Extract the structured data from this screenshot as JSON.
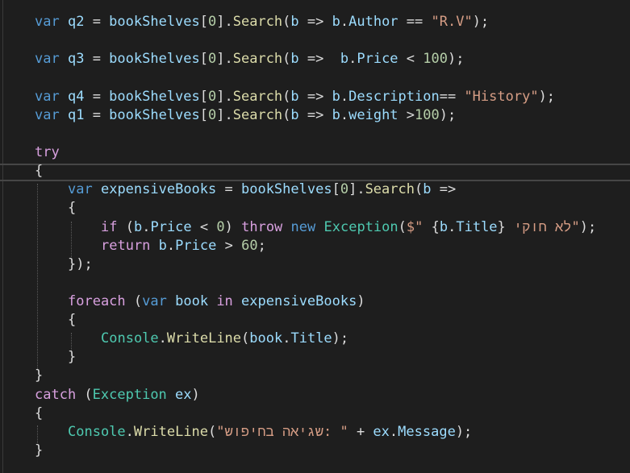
{
  "lines": [
    {
      "tokens": [
        {
          "t": "var",
          "c": "kw"
        },
        {
          "t": " ",
          "c": "pun"
        },
        {
          "t": "q2",
          "c": "id"
        },
        {
          "t": " = ",
          "c": "pun"
        },
        {
          "t": "bookShelves",
          "c": "id"
        },
        {
          "t": "[",
          "c": "pun"
        },
        {
          "t": "0",
          "c": "num"
        },
        {
          "t": "].",
          "c": "pun"
        },
        {
          "t": "Search",
          "c": "mth"
        },
        {
          "t": "(",
          "c": "pun"
        },
        {
          "t": "b",
          "c": "id"
        },
        {
          "t": " => ",
          "c": "pun"
        },
        {
          "t": "b",
          "c": "id"
        },
        {
          "t": ".",
          "c": "pun"
        },
        {
          "t": "Author",
          "c": "id"
        },
        {
          "t": " == ",
          "c": "pun"
        },
        {
          "t": "\"R.V\"",
          "c": "str"
        },
        {
          "t": ");",
          "c": "pun"
        }
      ]
    },
    {
      "tokens": [
        {
          "t": "var",
          "c": "kw"
        },
        {
          "t": " ",
          "c": "pun"
        },
        {
          "t": "q3",
          "c": "id"
        },
        {
          "t": " = ",
          "c": "pun"
        },
        {
          "t": "bookShelves",
          "c": "id"
        },
        {
          "t": "[",
          "c": "pun"
        },
        {
          "t": "0",
          "c": "num"
        },
        {
          "t": "].",
          "c": "pun"
        },
        {
          "t": "Search",
          "c": "mth"
        },
        {
          "t": "(",
          "c": "pun"
        },
        {
          "t": "b",
          "c": "id"
        },
        {
          "t": " =>  ",
          "c": "pun"
        },
        {
          "t": "b",
          "c": "id"
        },
        {
          "t": ".",
          "c": "pun"
        },
        {
          "t": "Price",
          "c": "id"
        },
        {
          "t": " < ",
          "c": "pun"
        },
        {
          "t": "100",
          "c": "num"
        },
        {
          "t": ");",
          "c": "pun"
        }
      ]
    },
    {
      "tokens": [
        {
          "t": "var",
          "c": "kw"
        },
        {
          "t": " ",
          "c": "pun"
        },
        {
          "t": "q4",
          "c": "id"
        },
        {
          "t": " = ",
          "c": "pun"
        },
        {
          "t": "bookShelves",
          "c": "id"
        },
        {
          "t": "[",
          "c": "pun"
        },
        {
          "t": "0",
          "c": "num"
        },
        {
          "t": "].",
          "c": "pun"
        },
        {
          "t": "Search",
          "c": "mth"
        },
        {
          "t": "(",
          "c": "pun"
        },
        {
          "t": "b",
          "c": "id"
        },
        {
          "t": " => ",
          "c": "pun"
        },
        {
          "t": "b",
          "c": "id"
        },
        {
          "t": ".",
          "c": "pun"
        },
        {
          "t": "Description",
          "c": "id"
        },
        {
          "t": "== ",
          "c": "pun"
        },
        {
          "t": "\"History\"",
          "c": "str"
        },
        {
          "t": ");",
          "c": "pun"
        }
      ]
    },
    {
      "tokens": [
        {
          "t": "var",
          "c": "kw"
        },
        {
          "t": " ",
          "c": "pun"
        },
        {
          "t": "q1",
          "c": "id"
        },
        {
          "t": " = ",
          "c": "pun"
        },
        {
          "t": "bookShelves",
          "c": "id"
        },
        {
          "t": "[",
          "c": "pun"
        },
        {
          "t": "0",
          "c": "num"
        },
        {
          "t": "].",
          "c": "pun"
        },
        {
          "t": "Search",
          "c": "mth"
        },
        {
          "t": "(",
          "c": "pun"
        },
        {
          "t": "b",
          "c": "id"
        },
        {
          "t": " => ",
          "c": "pun"
        },
        {
          "t": "b",
          "c": "id"
        },
        {
          "t": ".",
          "c": "pun"
        },
        {
          "t": "weight",
          "c": "id"
        },
        {
          "t": " >",
          "c": "pun"
        },
        {
          "t": "100",
          "c": "num"
        },
        {
          "t": ");",
          "c": "pun"
        }
      ]
    },
    {
      "tokens": [
        {
          "t": "try",
          "c": "ctl"
        }
      ]
    },
    {
      "tokens": [
        {
          "t": "{",
          "c": "pun"
        }
      ]
    },
    {
      "tokens": [
        {
          "t": "var",
          "c": "kw"
        },
        {
          "t": " ",
          "c": "pun"
        },
        {
          "t": "expensiveBooks",
          "c": "id"
        },
        {
          "t": " = ",
          "c": "pun"
        },
        {
          "t": "bookShelves",
          "c": "id"
        },
        {
          "t": "[",
          "c": "pun"
        },
        {
          "t": "0",
          "c": "num"
        },
        {
          "t": "].",
          "c": "pun"
        },
        {
          "t": "Search",
          "c": "mth"
        },
        {
          "t": "(",
          "c": "pun"
        },
        {
          "t": "b",
          "c": "id"
        },
        {
          "t": " =>",
          "c": "pun"
        }
      ]
    },
    {
      "tokens": [
        {
          "t": "{",
          "c": "pun"
        }
      ]
    },
    {
      "tokens": [
        {
          "t": "if",
          "c": "ctl"
        },
        {
          "t": " (",
          "c": "pun"
        },
        {
          "t": "b",
          "c": "id"
        },
        {
          "t": ".",
          "c": "pun"
        },
        {
          "t": "Price",
          "c": "id"
        },
        {
          "t": " < ",
          "c": "pun"
        },
        {
          "t": "0",
          "c": "num"
        },
        {
          "t": ") ",
          "c": "pun"
        },
        {
          "t": "throw",
          "c": "ctl"
        },
        {
          "t": " ",
          "c": "pun"
        },
        {
          "t": "new",
          "c": "kw"
        },
        {
          "t": " ",
          "c": "pun"
        },
        {
          "t": "Exception",
          "c": "cls"
        },
        {
          "t": "(",
          "c": "pun"
        },
        {
          "t": "$\" ",
          "c": "str"
        },
        {
          "t": "{",
          "c": "pun"
        },
        {
          "t": "b",
          "c": "id"
        },
        {
          "t": ".",
          "c": "pun"
        },
        {
          "t": "Title",
          "c": "id"
        },
        {
          "t": "}",
          "c": "pun"
        },
        {
          "t": " לא חוקי\"",
          "c": "str"
        },
        {
          "t": ");",
          "c": "pun"
        }
      ]
    },
    {
      "tokens": [
        {
          "t": "return",
          "c": "ctl"
        },
        {
          "t": " ",
          "c": "pun"
        },
        {
          "t": "b",
          "c": "id"
        },
        {
          "t": ".",
          "c": "pun"
        },
        {
          "t": "Price",
          "c": "id"
        },
        {
          "t": " > ",
          "c": "pun"
        },
        {
          "t": "60",
          "c": "num"
        },
        {
          "t": ";",
          "c": "pun"
        }
      ]
    },
    {
      "tokens": [
        {
          "t": "});",
          "c": "pun"
        }
      ]
    },
    {
      "tokens": [
        {
          "t": "foreach",
          "c": "ctl"
        },
        {
          "t": " (",
          "c": "pun"
        },
        {
          "t": "var",
          "c": "kw"
        },
        {
          "t": " ",
          "c": "pun"
        },
        {
          "t": "book",
          "c": "id"
        },
        {
          "t": " ",
          "c": "pun"
        },
        {
          "t": "in",
          "c": "ctl"
        },
        {
          "t": " ",
          "c": "pun"
        },
        {
          "t": "expensiveBooks",
          "c": "id"
        },
        {
          "t": ")",
          "c": "pun"
        }
      ]
    },
    {
      "tokens": [
        {
          "t": "{",
          "c": "pun"
        }
      ]
    },
    {
      "tokens": [
        {
          "t": "Console",
          "c": "cls"
        },
        {
          "t": ".",
          "c": "pun"
        },
        {
          "t": "WriteLine",
          "c": "mth"
        },
        {
          "t": "(",
          "c": "pun"
        },
        {
          "t": "book",
          "c": "id"
        },
        {
          "t": ".",
          "c": "pun"
        },
        {
          "t": "Title",
          "c": "id"
        },
        {
          "t": ");",
          "c": "pun"
        }
      ]
    },
    {
      "tokens": [
        {
          "t": "}",
          "c": "pun"
        }
      ]
    },
    {
      "tokens": [
        {
          "t": "}",
          "c": "pun"
        }
      ]
    },
    {
      "tokens": [
        {
          "t": "catch",
          "c": "ctl"
        },
        {
          "t": " (",
          "c": "pun"
        },
        {
          "t": "Exception",
          "c": "cls"
        },
        {
          "t": " ",
          "c": "pun"
        },
        {
          "t": "ex",
          "c": "id"
        },
        {
          "t": ")",
          "c": "pun"
        }
      ]
    },
    {
      "tokens": [
        {
          "t": "{",
          "c": "pun"
        }
      ]
    },
    {
      "tokens": [
        {
          "t": "Console",
          "c": "cls"
        },
        {
          "t": ".",
          "c": "pun"
        },
        {
          "t": "WriteLine",
          "c": "mth"
        },
        {
          "t": "(",
          "c": "pun"
        },
        {
          "t": "\"שגיאה בחיפוש: \"",
          "c": "str"
        },
        {
          "t": " + ",
          "c": "pun"
        },
        {
          "t": "ex",
          "c": "id"
        },
        {
          "t": ".",
          "c": "pun"
        },
        {
          "t": "Message",
          "c": "id"
        },
        {
          "t": ");",
          "c": "pun"
        }
      ]
    },
    {
      "tokens": [
        {
          "t": "}",
          "c": "pun"
        }
      ]
    }
  ]
}
